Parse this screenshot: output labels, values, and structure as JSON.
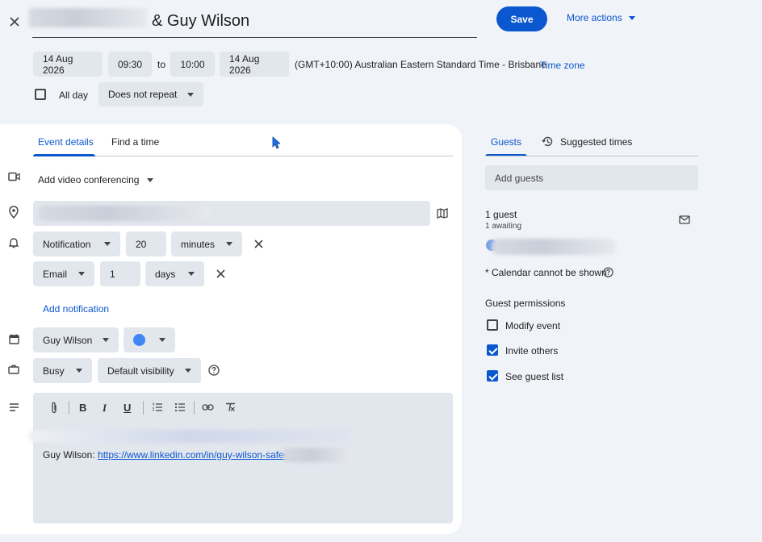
{
  "header": {
    "title_suffix": "& Guy Wilson",
    "save_label": "Save",
    "more_actions_label": "More actions"
  },
  "datetime": {
    "start_date": "14 Aug 2026",
    "start_time": "09:30",
    "to_label": "to",
    "end_time": "10:00",
    "end_date": "14 Aug 2026",
    "timezone": "(GMT+10:00) Australian Eastern Standard Time - Brisbane",
    "timezone_link": "Time zone",
    "all_day_label": "All day",
    "repeat": "Does not repeat"
  },
  "tabs": {
    "event_details": "Event details",
    "find_a_time": "Find a time"
  },
  "details": {
    "video_conferencing": "Add video conferencing",
    "notification1": {
      "type": "Notification",
      "value": "20",
      "unit": "minutes"
    },
    "notification2": {
      "type": "Email",
      "value": "1",
      "unit": "days"
    },
    "add_notification": "Add notification",
    "calendar_owner": "Guy Wilson",
    "busy": "Busy",
    "visibility": "Default visibility",
    "description_prefix": "Guy Wilson: ",
    "description_link": "https://www.linkedin.com/in/guy-wilson-safeur/"
  },
  "guests_panel": {
    "tab_guests": "Guests",
    "tab_suggested": "Suggested times",
    "add_guests_placeholder": "Add guests",
    "guest_count": "1 guest",
    "awaiting": "1 awaiting",
    "calendar_note": "* Calendar cannot be shown",
    "permissions_title": "Guest permissions",
    "perm_modify": "Modify event",
    "perm_invite": "Invite others",
    "perm_see": "See guest list"
  },
  "colors": {
    "accent": "#0b57d0",
    "event_color": "#4285f4"
  }
}
